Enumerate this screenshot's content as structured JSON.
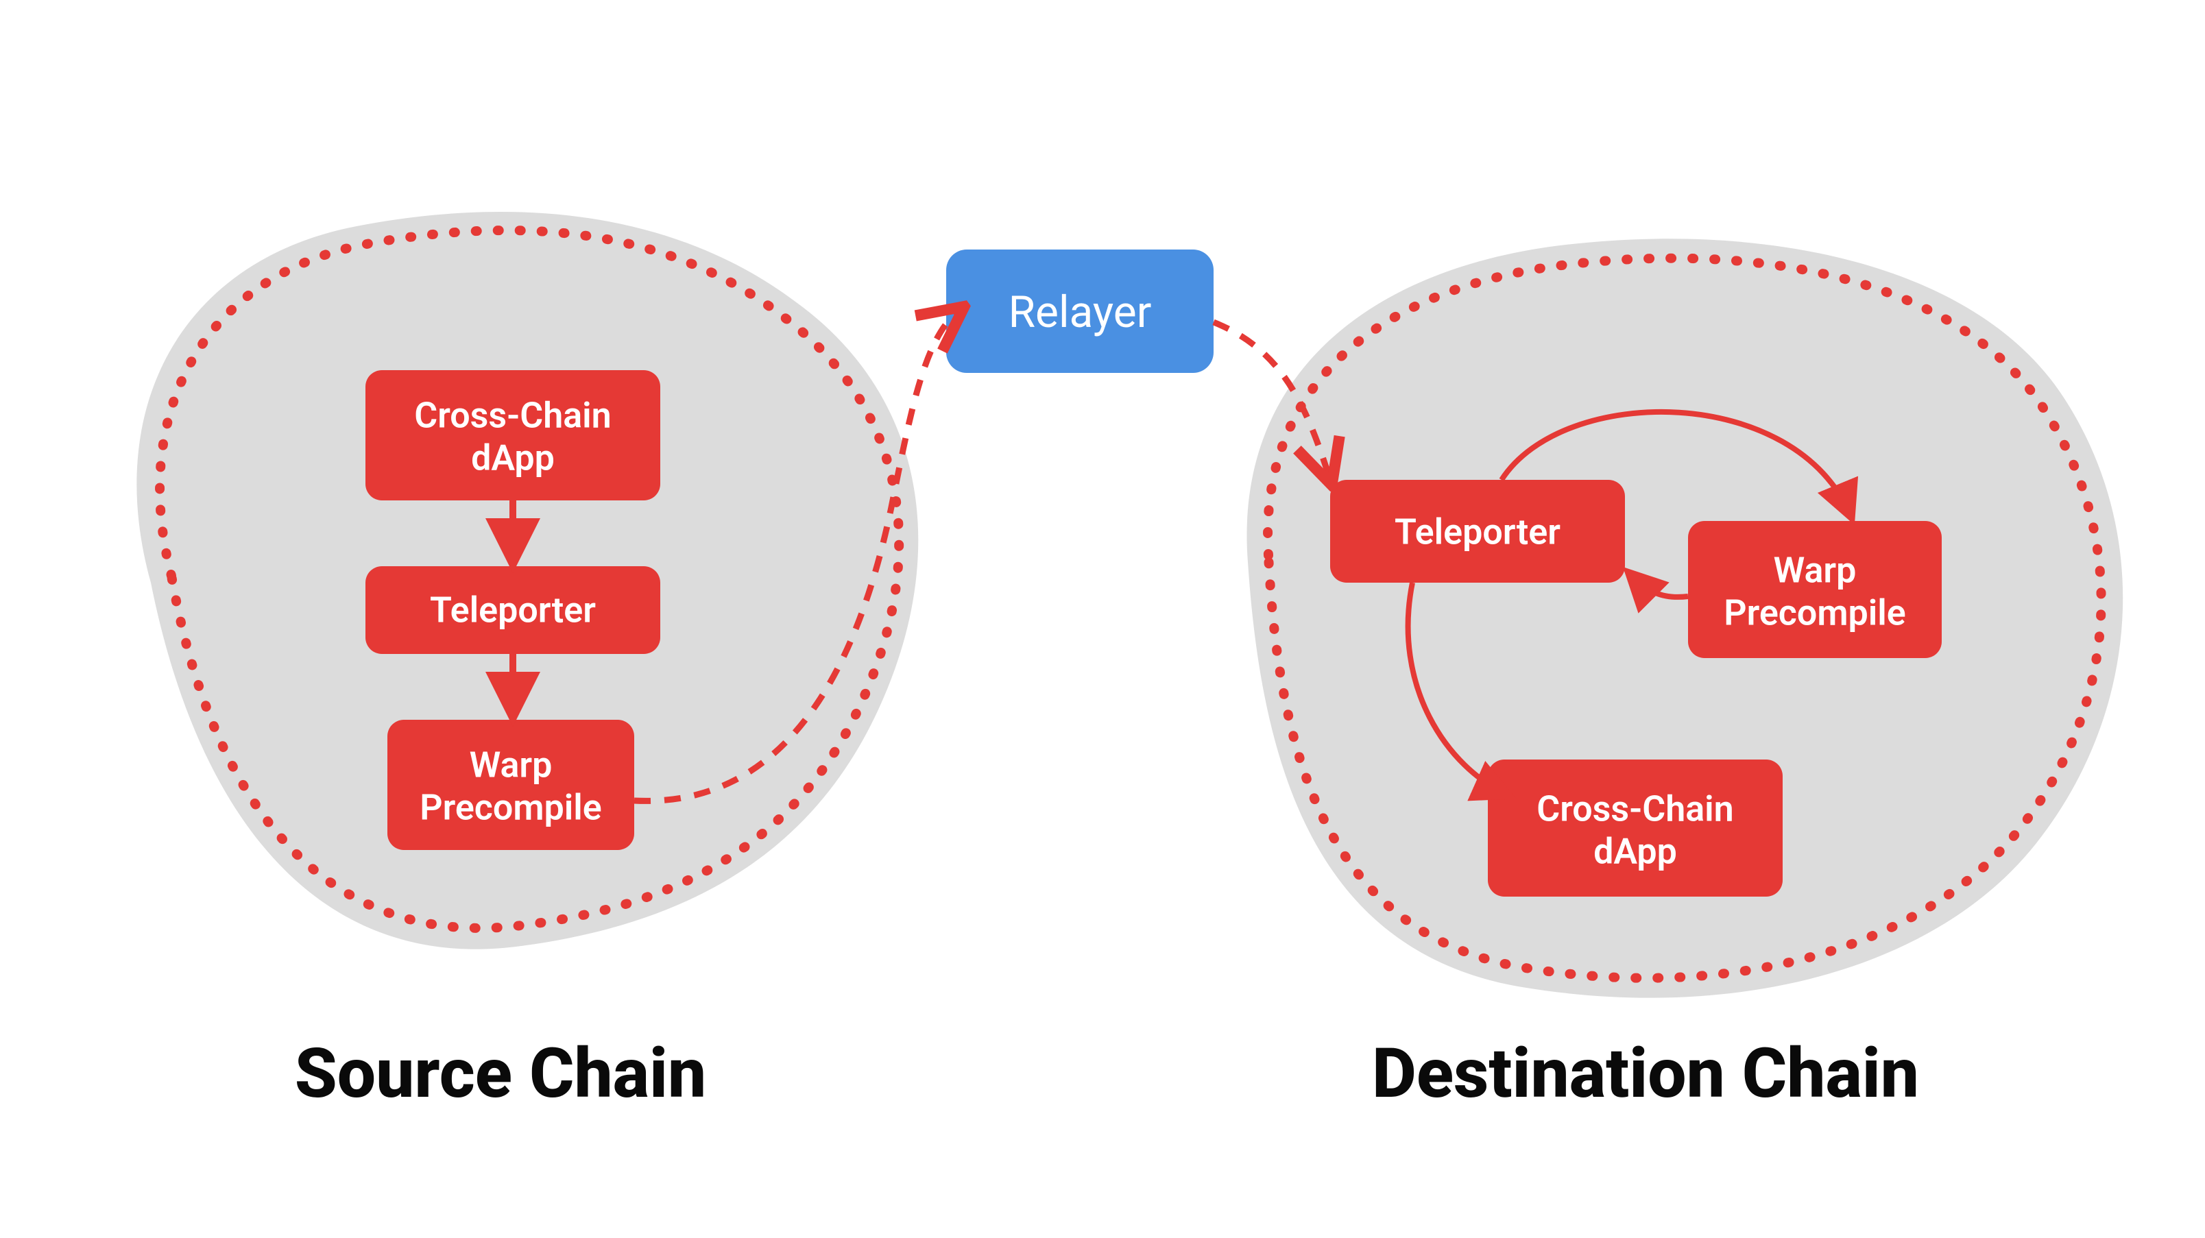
{
  "colors": {
    "red": "#e53935",
    "blue": "#4a90e2",
    "blob": "#dcdcdc",
    "text_dark": "#0a0a0a",
    "text_light": "#ffffff"
  },
  "relayer": {
    "label": "Relayer"
  },
  "source": {
    "title": "Source Chain",
    "nodes": {
      "dapp_line1": "Cross-Chain",
      "dapp_line2": "dApp",
      "teleporter": "Teleporter",
      "warp_line1": "Warp",
      "warp_line2": "Precompile"
    }
  },
  "destination": {
    "title": "Destination Chain",
    "nodes": {
      "teleporter": "Teleporter",
      "warp_line1": "Warp",
      "warp_line2": "Precompile",
      "dapp_line1": "Cross-Chain",
      "dapp_line2": "dApp"
    }
  }
}
